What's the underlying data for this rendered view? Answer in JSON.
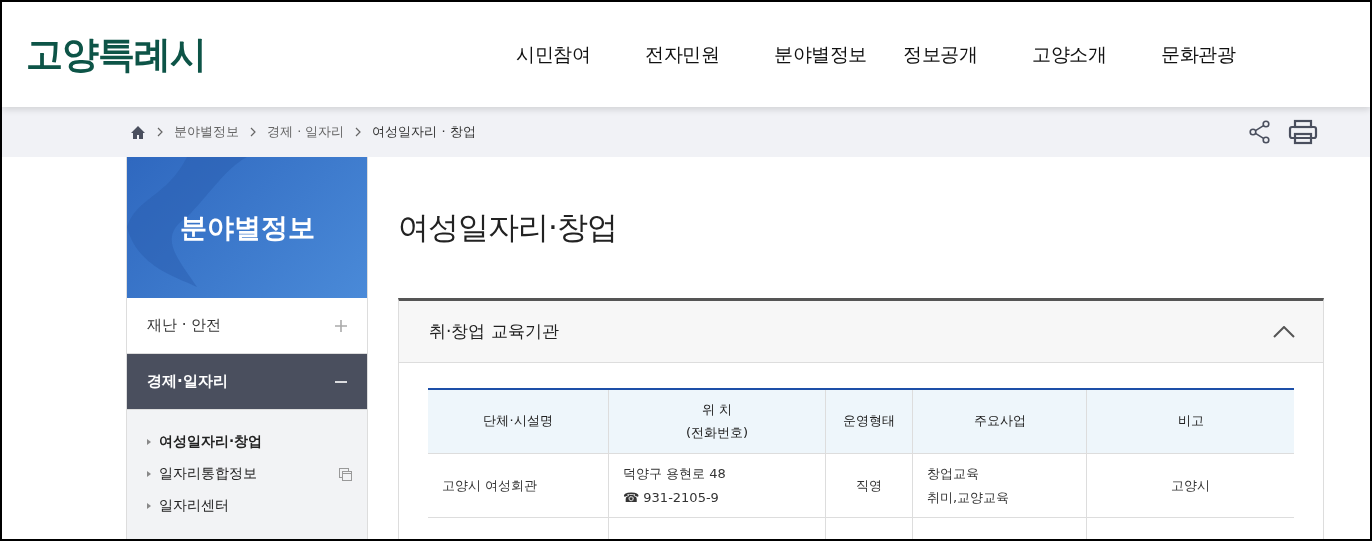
{
  "header": {
    "logo": "고양특례시",
    "nav": [
      {
        "label": "시민참여"
      },
      {
        "label": "전자민원"
      },
      {
        "label": "분야별정보"
      },
      {
        "label": "정보공개"
      },
      {
        "label": "고양소개"
      },
      {
        "label": "문화관광"
      }
    ]
  },
  "breadcrumb": [
    "분야별정보",
    "경제 · 일자리",
    "여성일자리 · 창업"
  ],
  "sidebar": {
    "title": "분야별정보",
    "items": [
      {
        "label": "재난 · 안전",
        "expanded": false
      },
      {
        "label": "경제·일자리",
        "expanded": true,
        "children": [
          {
            "label": "여성일자리·창업",
            "selected": true,
            "external": false
          },
          {
            "label": "일자리통합정보",
            "selected": false,
            "external": true
          },
          {
            "label": "일자리센터",
            "selected": false,
            "external": false
          }
        ]
      }
    ]
  },
  "page_title": "여성일자리·창업",
  "section": {
    "title": "취·창업 교육기관",
    "expanded": true,
    "table": {
      "columns": [
        "단체·시설명",
        "위 치\n(전화번호)",
        "운영형태",
        "주요사업",
        "비고"
      ],
      "rows": [
        [
          "고양시 여성회관",
          "덕양구 용현로 48\n☎ 931-2105-9",
          "직영",
          "창업교육\n취미,교양교육",
          "고양시"
        ]
      ]
    }
  }
}
